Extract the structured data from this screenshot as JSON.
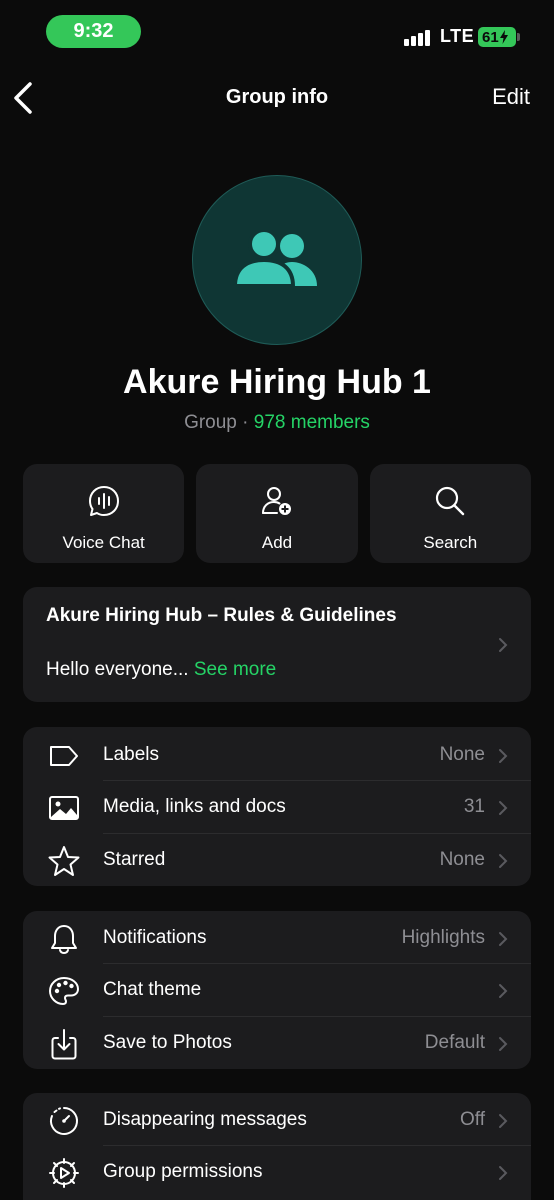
{
  "status_bar": {
    "time": "9:32",
    "network": "LTE",
    "battery": "61"
  },
  "nav": {
    "title": "Group info",
    "edit_label": "Edit"
  },
  "header": {
    "group_name": "Akure Hiring Hub 1",
    "type": "Group",
    "separator": " · ",
    "members": "978 members"
  },
  "actions": [
    {
      "label": "Voice Chat",
      "icon": "voice-chat-icon"
    },
    {
      "label": "Add",
      "icon": "add-member-icon"
    },
    {
      "label": "Search",
      "icon": "search-icon"
    }
  ],
  "description": {
    "title": "Akure Hiring Hub – Rules & Guidelines",
    "text": "Hello everyone... ",
    "see_more": "See more"
  },
  "section1": [
    {
      "label": "Labels",
      "value": "None",
      "icon": "label-icon"
    },
    {
      "label": "Media, links and docs",
      "value": "31",
      "icon": "image-icon"
    },
    {
      "label": "Starred",
      "value": "None",
      "icon": "star-icon"
    }
  ],
  "section2": [
    {
      "label": "Notifications",
      "value": "Highlights",
      "icon": "bell-icon"
    },
    {
      "label": "Chat theme",
      "value": "",
      "icon": "palette-icon"
    },
    {
      "label": "Save to Photos",
      "value": "Default",
      "icon": "save-download-icon"
    }
  ],
  "section3": [
    {
      "label": "Disappearing messages",
      "value": "Off",
      "icon": "timer-icon"
    },
    {
      "label": "Group permissions",
      "value": "",
      "icon": "gear-icon"
    }
  ],
  "colors": {
    "accent": "#25d366",
    "status_green": "#34c759",
    "card": "#1c1c1e",
    "avatar_bg": "#0f3634",
    "avatar_icon": "#3ec8b6"
  }
}
